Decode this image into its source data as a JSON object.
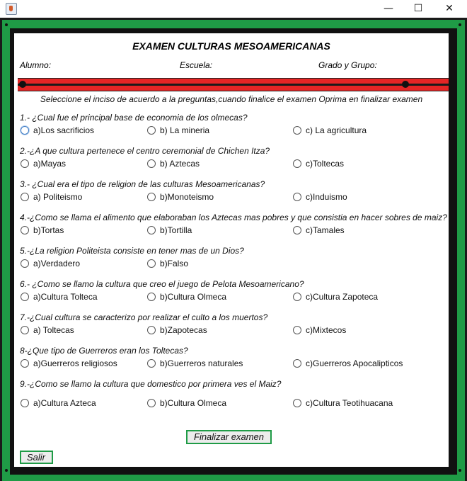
{
  "window": {
    "minimize_glyph": "—",
    "maximize_glyph": "☐",
    "close_glyph": "✕"
  },
  "exam": {
    "title": "EXAMEN CULTURAS MESOAMERICANAS",
    "student_label": "Alumno:",
    "school_label": "Escuela:",
    "grade_label": "Grado y Grupo:",
    "instructions": "Seleccione el inciso de acuerdo a la preguntas,cuando finalice el examen  Oprima en finalizar examen"
  },
  "questions": [
    {
      "text": "1.- ¿Cual fue el principal base de economia de los olmecas?",
      "options": [
        "a)Los sacrificios",
        "b) La mineria",
        "c) La agricultura"
      ]
    },
    {
      "text": "2.-¿A que cultura pertenece el centro ceremonial de Chichen Itza?",
      "options": [
        "a)Mayas",
        "b) Aztecas",
        "c)Toltecas"
      ]
    },
    {
      "text": "3.- ¿Cual era el tipo de religion  de las culturas Mesoamericanas?",
      "options": [
        "a) Politeismo",
        "b)Monoteismo",
        "c)Induismo"
      ]
    },
    {
      "text": "4.-¿Como se llama el alimento que elaboraban los Aztecas mas pobres y que consistia en hacer sobres de maiz?",
      "options": [
        "b)Tortas",
        "b)Tortilla",
        "c)Tamales"
      ]
    },
    {
      "text": "5.-¿La religion Politeista consiste en tener mas de un Dios?",
      "options": [
        "a)Verdadero",
        "b)Falso"
      ]
    },
    {
      "text": "6.- ¿Como se llamo la cultura que creo el juego de Pelota Mesoamericano?",
      "options": [
        "a)Cultura Tolteca",
        "b)Cultura Olmeca",
        "c)Cultura Zapoteca"
      ]
    },
    {
      "text": "7.-¿Cual cultura se caracterizo por realizar el culto a los muertos?",
      "options": [
        "a) Toltecas",
        "b)Zapotecas",
        "c)Mixtecos"
      ]
    },
    {
      "text": "8-¿Que tipo de Guerreros eran los Toltecas?",
      "options": [
        "a)Guerreros religiosos",
        "b)Guerreros naturales",
        "c)Guerreros Apocalipticos"
      ]
    },
    {
      "text": "9.-¿Como se llamo la cultura que domestico por primera ves el Maiz?",
      "options": [
        "a)Cultura Azteca",
        "b)Cultura Olmeca",
        "c)Cultura Teotihuacana"
      ]
    }
  ],
  "buttons": {
    "finish": "Finalizar examen",
    "exit": "Salir"
  },
  "colors": {
    "frame_green": "#1f9b46",
    "band_red": "#e52525",
    "frame_black": "#111111"
  }
}
